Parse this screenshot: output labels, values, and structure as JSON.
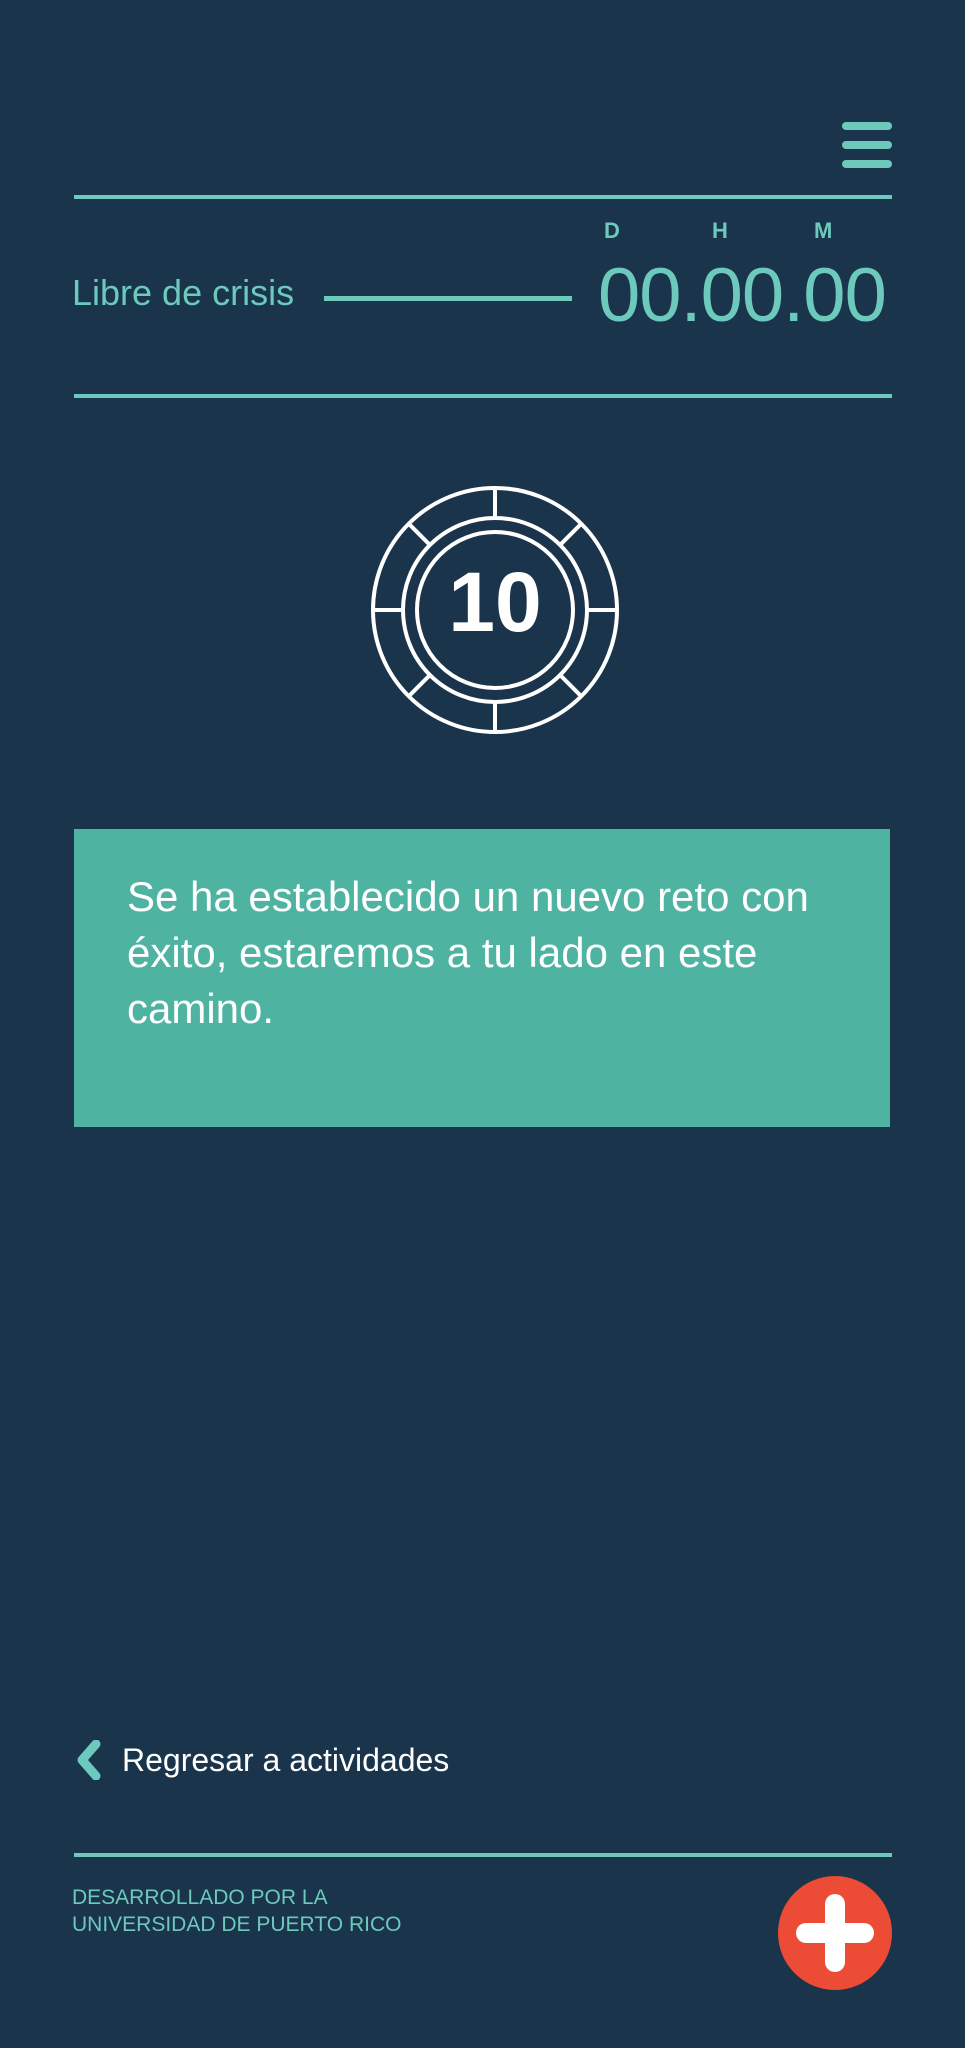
{
  "header": {
    "menu_icon": "hamburger-menu-icon"
  },
  "timer": {
    "label": "Libre de crisis",
    "units": [
      "D",
      "H",
      "M"
    ],
    "value": "00.00.00"
  },
  "chip": {
    "icon": "poker-chip-icon",
    "number": "10"
  },
  "message": {
    "text": "Se ha establecido un nuevo reto con éxito, estaremos a tu lado en este camino."
  },
  "navigation": {
    "back_icon": "chevron-left-icon",
    "back_label": "Regresar a actividades"
  },
  "footer": {
    "credit_line1": "DESARROLLADO POR LA",
    "credit_line2": "UNIVERSIDAD DE PUERTO RICO",
    "emergency_icon": "plus-icon"
  },
  "colors": {
    "background": "#1a344b",
    "accent": "#6cc9bc",
    "message_box": "#4fb3a1",
    "emergency": "#ec4b36",
    "text_light": "#ffffff"
  }
}
